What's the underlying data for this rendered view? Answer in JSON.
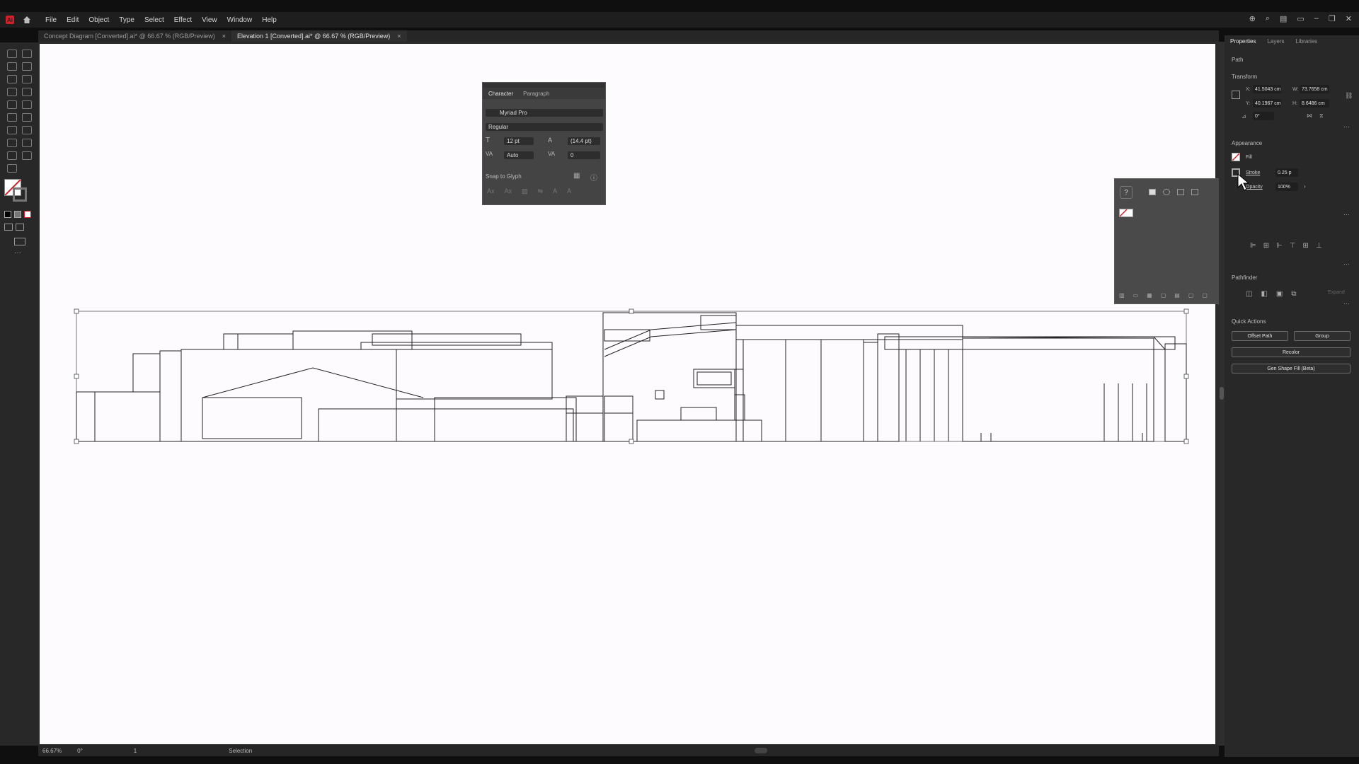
{
  "app": {
    "logo_text": "Ai"
  },
  "menu": [
    "File",
    "Edit",
    "Object",
    "Type",
    "Select",
    "Effect",
    "View",
    "Window",
    "Help"
  ],
  "tabs": [
    {
      "label": "Concept Diagram [Converted].ai* @ 66.67 % (RGB/Preview)",
      "close": "×"
    },
    {
      "label": "Elevation 1 [Converted].ai* @ 66.67 % (RGB/Preview)",
      "close": "×"
    }
  ],
  "status": {
    "zoom": "66.67%",
    "rotation": "0°",
    "page": "1",
    "tool": "Selection"
  },
  "character_panel": {
    "tabs": [
      "Character",
      "Paragraph"
    ],
    "font_family": "Myriad Pro",
    "font_style": "Regular",
    "font_size": "12 pt",
    "leading": "(14.4 pt)",
    "kerning": "Auto",
    "tracking": "0",
    "snap_label": "Snap to Glyph"
  },
  "floating_panel": {
    "help": "?"
  },
  "properties": {
    "tabs": [
      "Properties",
      "Layers",
      "Libraries"
    ],
    "selection_type": "Path",
    "transform": {
      "title": "Transform",
      "x_label": "X:",
      "x": "41.5043 cm",
      "y_label": "Y:",
      "y": "40.1967 cm",
      "w_label": "W:",
      "w": "73.7658 cm",
      "h_label": "H:",
      "h": "8.6486 cm",
      "angle": "0°"
    },
    "appearance": {
      "title": "Appearance",
      "fill_label": "Fill",
      "stroke_label": "Stroke",
      "stroke_value": "0.25 p",
      "opacity_label": "Opacity",
      "opacity_value": "100%"
    },
    "pathfinder_label": "Pathfinder",
    "expand_label": "Expand",
    "quick_actions": {
      "title": "Quick Actions",
      "offset_path": "Offset Path",
      "group": "Group",
      "recolor": "Recolor",
      "gen_shape_fill": "Gen Shape Fill (Beta)"
    }
  },
  "colors": {
    "accent_red": "#d4202a",
    "artboard": "#fdfbfe",
    "panel": "#282828"
  }
}
